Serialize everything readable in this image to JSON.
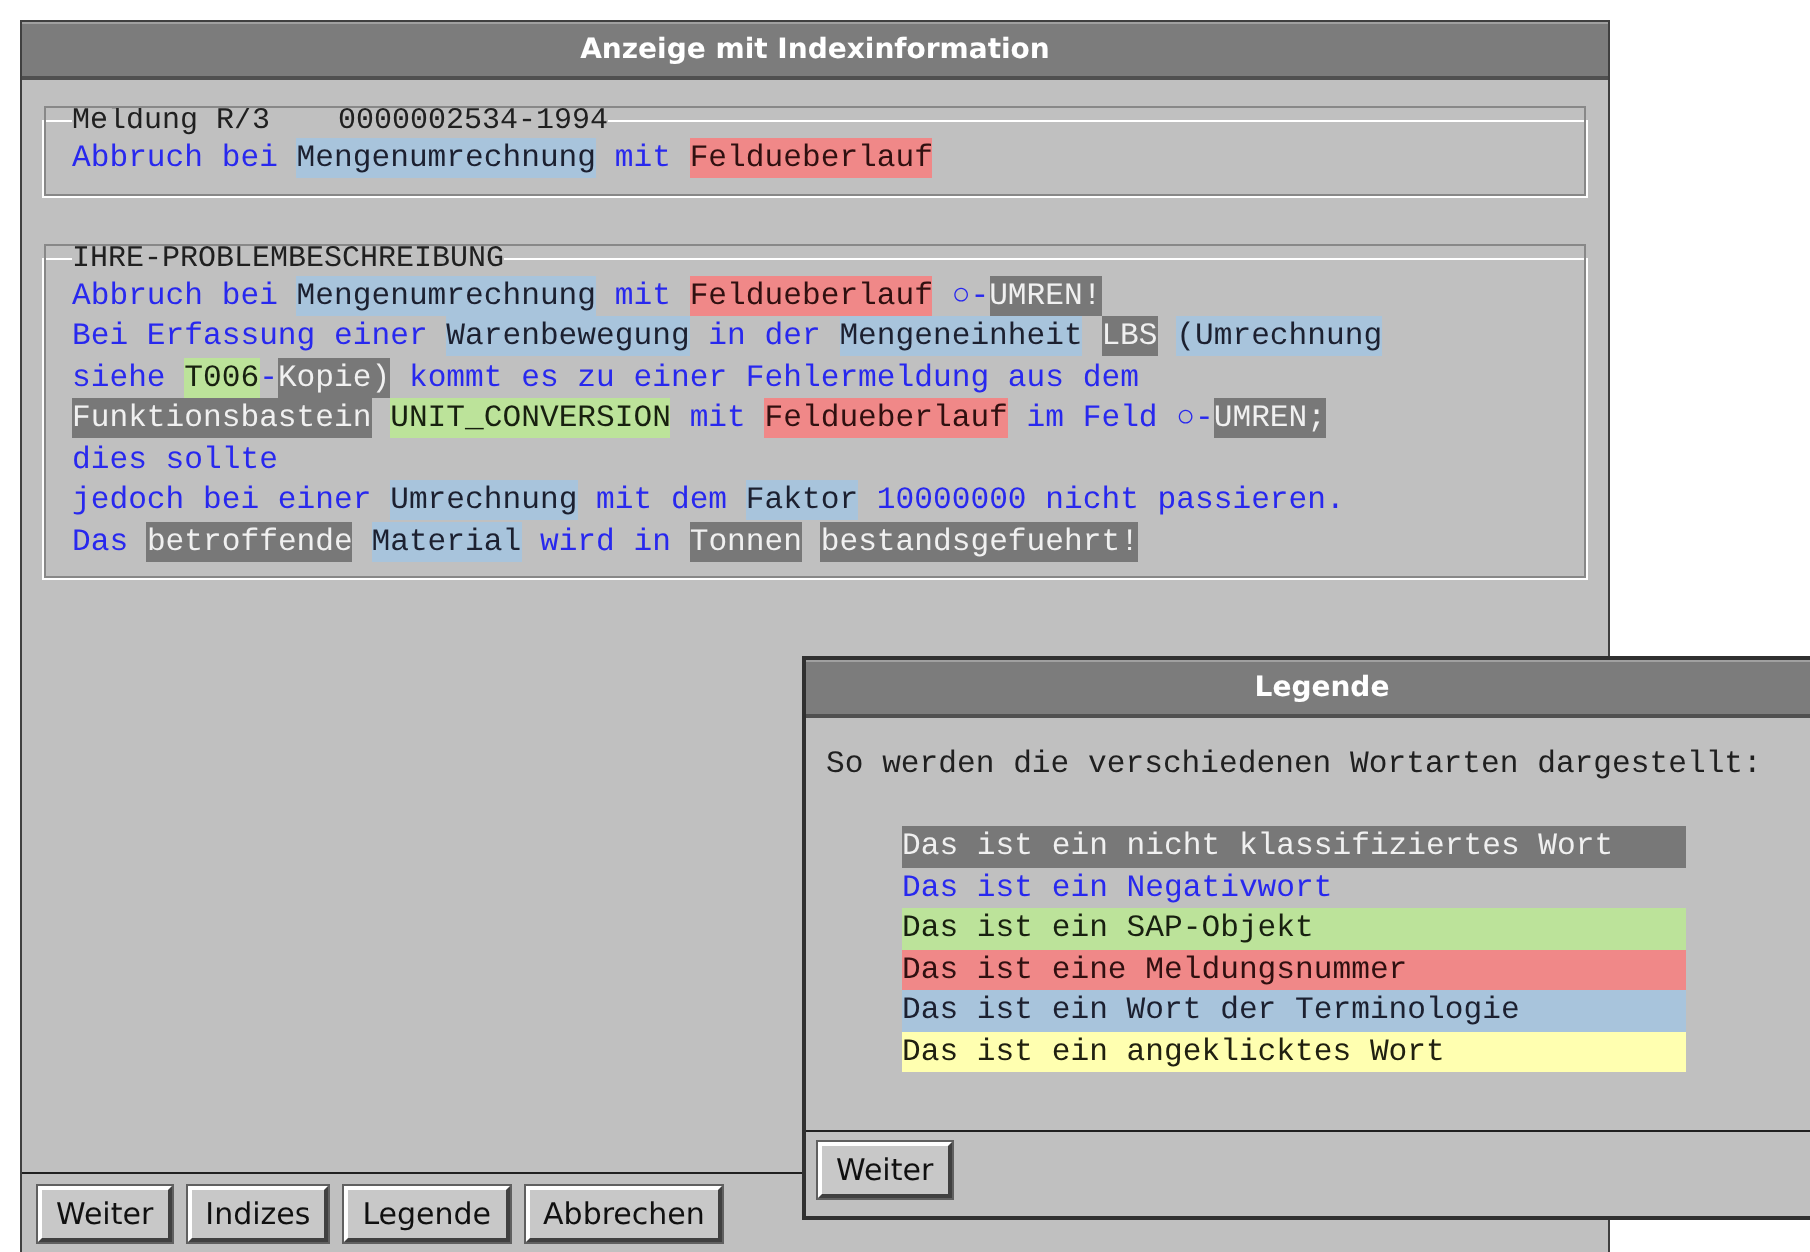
{
  "window": {
    "title": "Anzeige mit Indexinformation"
  },
  "message": {
    "legend": "Meldung R/3",
    "number": "0000002534-1994",
    "lines": [
      [
        {
          "text": "Abbruch bei ",
          "kind": "negative"
        },
        {
          "text": "Mengenumrechnung",
          "kind": "term"
        },
        {
          "text": " mit ",
          "kind": "negative"
        },
        {
          "text": "Feldueberlauf",
          "kind": "message"
        }
      ]
    ]
  },
  "problem": {
    "legend": "IHRE-PROBLEMBESCHREIBUNG",
    "lines": [
      [
        {
          "text": "Abbruch bei ",
          "kind": "negative"
        },
        {
          "text": "Mengenumrechnung",
          "kind": "term"
        },
        {
          "text": " mit ",
          "kind": "negative"
        },
        {
          "text": "Feldueberlauf",
          "kind": "message"
        },
        {
          "text": " ○-",
          "kind": "negative"
        },
        {
          "text": "UMREN!",
          "kind": "unclassified"
        }
      ],
      [
        {
          "text": "Bei Erfassung einer ",
          "kind": "negative"
        },
        {
          "text": "Warenbewegung",
          "kind": "term"
        },
        {
          "text": " in der ",
          "kind": "negative"
        },
        {
          "text": "Mengeneinheit",
          "kind": "term"
        },
        {
          "text": "LBS",
          "kind": "unclassified"
        },
        {
          "text": "(Umrechnung",
          "kind": "term"
        }
      ],
      [
        {
          "text": "siehe ",
          "kind": "negative"
        },
        {
          "text": "T006",
          "kind": "sap"
        },
        {
          "text": "-",
          "kind": "negative"
        },
        {
          "text": "Kopie)",
          "kind": "unclassified"
        },
        {
          "text": " kommt es zu einer Fehlermeldung aus dem",
          "kind": "negative"
        }
      ],
      [
        {
          "text": "Funktionsbastein",
          "kind": "unclassified"
        },
        {
          "text": "UNIT_CONVERSION",
          "kind": "sap"
        },
        {
          "text": " mit ",
          "kind": "negative"
        },
        {
          "text": "Feldueberlauf",
          "kind": "message"
        },
        {
          "text": " im Feld ○-",
          "kind": "negative"
        },
        {
          "text": "UMREN;",
          "kind": "unclassified"
        }
      ],
      [
        {
          "text": "dies sollte",
          "kind": "negative"
        }
      ],
      [
        {
          "text": "jedoch bei einer ",
          "kind": "negative"
        },
        {
          "text": "Umrechnung",
          "kind": "term"
        },
        {
          "text": " mit dem ",
          "kind": "negative"
        },
        {
          "text": "Faktor",
          "kind": "term"
        },
        {
          "text": " 10000000 nicht passieren.",
          "kind": "negative"
        }
      ],
      [
        {
          "text": "Das ",
          "kind": "negative"
        },
        {
          "text": "betroffende",
          "kind": "unclassified"
        },
        {
          "text": "Material",
          "kind": "term"
        },
        {
          "text": " wird in ",
          "kind": "negative"
        },
        {
          "text": "Tonnen",
          "kind": "unclassified"
        },
        {
          "text": "bestandsgefuehrt!",
          "kind": "unclassified"
        }
      ]
    ]
  },
  "buttons": [
    "Weiter",
    "Indizes",
    "Legende",
    "Abbrechen"
  ],
  "legend_dialog": {
    "title": "Legende",
    "intro": "So werden die verschiedenen Wortarten dargestellt:",
    "entries": [
      {
        "text": "Das ist ein nicht klassifiziertes Wort",
        "kind": "unclassified"
      },
      {
        "text": "Das ist ein Negativwort",
        "kind": "negative"
      },
      {
        "text": "Das ist ein SAP-Objekt",
        "kind": "sap"
      },
      {
        "text": "Das ist eine Meldungsnummer",
        "kind": "message"
      },
      {
        "text": "Das ist ein Wort der Terminologie",
        "kind": "term"
      },
      {
        "text": "Das ist ein angeklicktes Wort",
        "kind": "clicked"
      }
    ],
    "buttons": [
      "Weiter"
    ]
  }
}
